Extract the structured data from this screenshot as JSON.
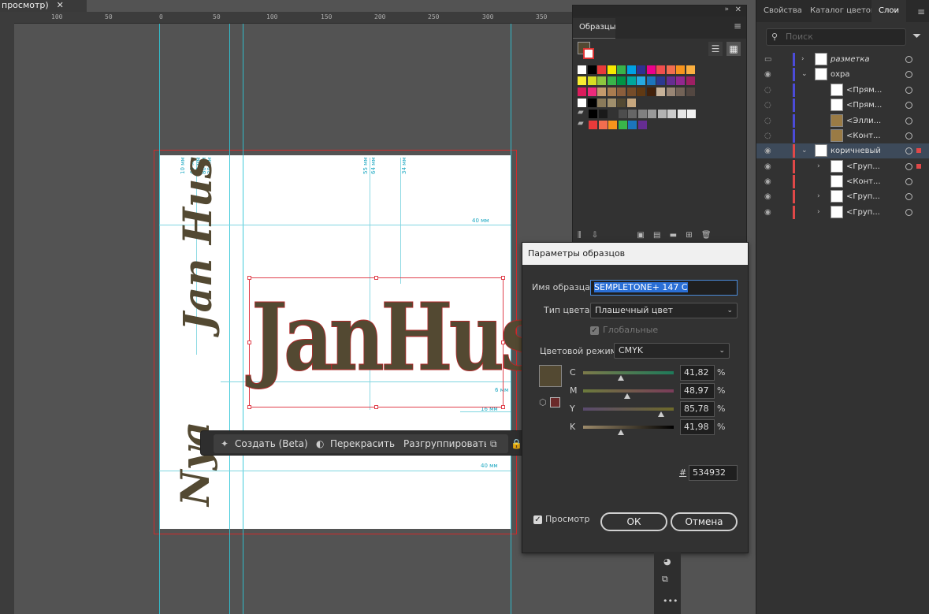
{
  "doc_tab": {
    "label": "просмотр)",
    "close": "✕"
  },
  "ruler": {
    "ticks": [
      "100",
      "50",
      "0",
      "50",
      "100",
      "150",
      "200",
      "250",
      "300",
      "350"
    ]
  },
  "artboard": {
    "vertical_text_top": "Jan Hus",
    "vertical_text_bottom": "Nya",
    "logo_text": "JanHus",
    "dims": [
      "10 мм",
      "40 мм",
      "60 мм",
      "80 мм",
      "30 мм",
      "55 мм",
      "64 мм",
      "34 мм",
      "40 мм",
      "6 мм",
      "16 мм",
      "40 мм",
      "4"
    ]
  },
  "context_bar": {
    "create_label": "Создать (Beta)",
    "recolor_label": "Перекрасить",
    "ungroup_label": "Разгруппировать"
  },
  "swatches_panel": {
    "tab": "Образцы",
    "colors": {
      "row1": [
        "#ffffff",
        "#000000",
        "#e83a3a",
        "#f7e800",
        "#38b34a",
        "#00a1e4",
        "#2e3192",
        "#ec008c",
        "#f04e4e",
        "#f26d4f",
        "#f7941d",
        "#fbb040"
      ],
      "row2": [
        "#f9ed32",
        "#d7df23",
        "#8dc63f",
        "#39b54a",
        "#009444",
        "#00a79d",
        "#27aae1",
        "#1c75bc",
        "#2b3990",
        "#662d91",
        "#92278f",
        "#9e1f63"
      ],
      "row3": [
        "#da1c5c",
        "#ee2a7b",
        "#c49a6c",
        "#a97c50",
        "#8b5e3c",
        "#754c29",
        "#603913",
        "#42210b",
        "#c7b299",
        "#998675",
        "#736357",
        "#534741"
      ],
      "row4": [
        "#ffffff",
        "#000000",
        "#8a7a5a",
        "#a08f6c",
        "#534932",
        "#c7a77e"
      ],
      "row5": [
        "#000000",
        "#1a1a1a",
        "#333333",
        "#4d4d4d",
        "#666666",
        "#808080",
        "#999999",
        "#b3b3b3",
        "#cccccc",
        "#e6e6e6",
        "#f2f2f2"
      ],
      "row6": [
        "#e83a3a",
        "#f26d4f",
        "#f7941d",
        "#39b54a",
        "#1c75bc",
        "#662d91"
      ]
    }
  },
  "right_panel": {
    "tabs": [
      "Свойства",
      "Каталог цветов",
      "Слои"
    ],
    "search_placeholder": "Поиск",
    "layers": [
      {
        "name": "разметка",
        "italic": true,
        "color": "#4b4bd8"
      },
      {
        "name": "охра",
        "italic": false,
        "color": "#4b4bd8"
      },
      {
        "name": "<Прям...",
        "italic": false,
        "color": "#4b4bd8"
      },
      {
        "name": "<Прям...",
        "italic": false,
        "color": "#4b4bd8"
      },
      {
        "name": "<Элли...",
        "italic": false,
        "color": "#4b4bd8"
      },
      {
        "name": "<Конт...",
        "italic": false,
        "color": "#4b4bd8"
      },
      {
        "name": "коричневый",
        "italic": false,
        "color": "#e04848"
      },
      {
        "name": "<Груп...",
        "italic": false,
        "color": "#e04848"
      },
      {
        "name": "<Конт...",
        "italic": false,
        "color": "#e04848"
      },
      {
        "name": "<Груп...",
        "italic": false,
        "color": "#e04848"
      },
      {
        "name": "<Груп...",
        "italic": false,
        "color": "#e04848"
      }
    ]
  },
  "dialog": {
    "title": "Параметры образцов",
    "name_label": "Имя образца:",
    "name_value": "SEMPLETONE+ 147 C",
    "color_type_label": "Тип цвета:",
    "color_type_value": "Плашечный цвет",
    "global_label": "Глобальные",
    "color_mode_label": "Цветовой режим:",
    "color_mode_value": "CMYK",
    "channels": [
      {
        "label": "C",
        "value": "41,82",
        "fraction": 0.4182
      },
      {
        "label": "M",
        "value": "48,97",
        "fraction": 0.4897
      },
      {
        "label": "Y",
        "value": "85,78",
        "fraction": 0.8578
      },
      {
        "label": "K",
        "value": "41,98",
        "fraction": 0.4198
      }
    ],
    "percent": "%",
    "hex_label": "#",
    "hex_value": "534932",
    "swatch_color": "#534932",
    "preview_label": "Просмотр",
    "ok_label": "ОК",
    "cancel_label": "Отмена"
  }
}
